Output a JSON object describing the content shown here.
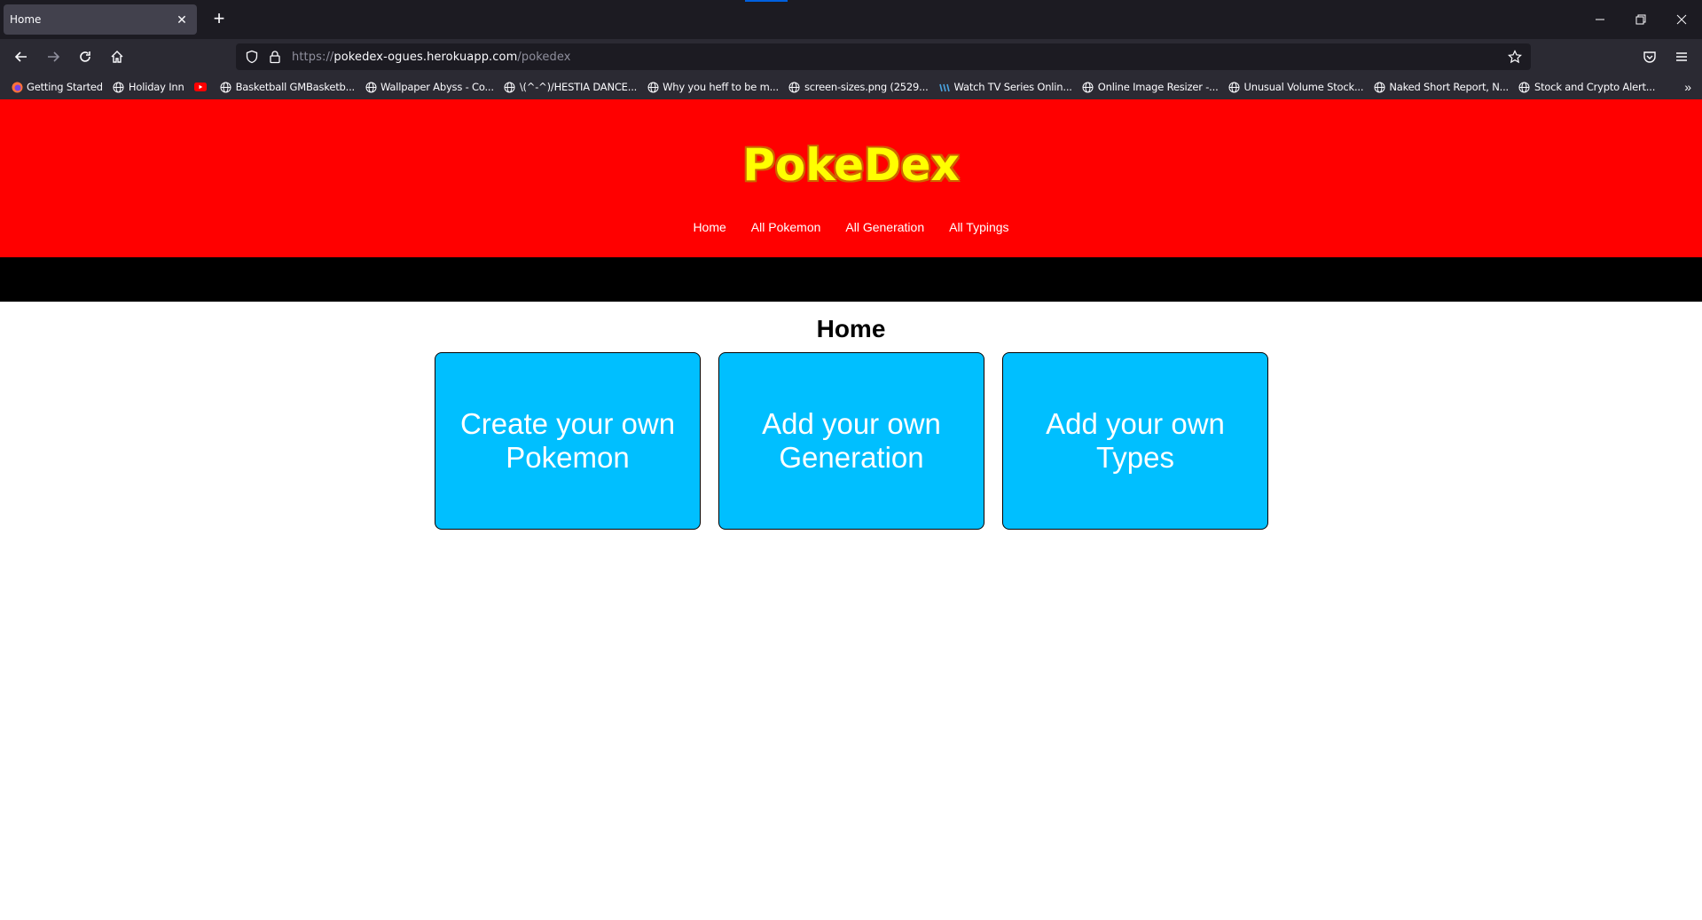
{
  "browser": {
    "tab_title": "Home",
    "url_scheme": "https://",
    "url_host": "pokedex-ogues.herokuapp.com",
    "url_path": "/pokedex",
    "bookmarks": [
      {
        "label": "Getting Started",
        "icon": "firefox-icon"
      },
      {
        "label": "Holiday Inn",
        "icon": "globe-icon"
      },
      {
        "label": "",
        "icon": "youtube-icon"
      },
      {
        "label": "Basketball GMBasketb...",
        "icon": "globe-icon"
      },
      {
        "label": "Wallpaper Abyss - Co...",
        "icon": "globe-icon"
      },
      {
        "label": "\\(^-^)/HESTIA DANCE...",
        "icon": "globe-icon"
      },
      {
        "label": "Why you heff to be m...",
        "icon": "globe-icon"
      },
      {
        "label": "screen-sizes.png (2529...",
        "icon": "globe-icon"
      },
      {
        "label": "Watch TV Series Onlin...",
        "icon": "tv-icon"
      },
      {
        "label": "Online Image Resizer -...",
        "icon": "globe-icon"
      },
      {
        "label": "Unusual Volume Stock...",
        "icon": "globe-icon"
      },
      {
        "label": "Naked Short Report, N...",
        "icon": "globe-icon"
      },
      {
        "label": "Stock and Crypto Alert...",
        "icon": "globe-icon"
      }
    ]
  },
  "site": {
    "logo": "PokeDex",
    "nav": [
      "Home",
      "All Pokemon",
      "All Generation",
      "All Typings"
    ]
  },
  "main": {
    "heading": "Home",
    "cards": [
      "Create your own Pokemon",
      "Add your own Generation",
      "Add your own Types"
    ]
  },
  "colors": {
    "header_bg": "#ff0000",
    "logo_fill": "#ffff00",
    "card_bg": "#00bfff",
    "band_bg": "#000000"
  }
}
